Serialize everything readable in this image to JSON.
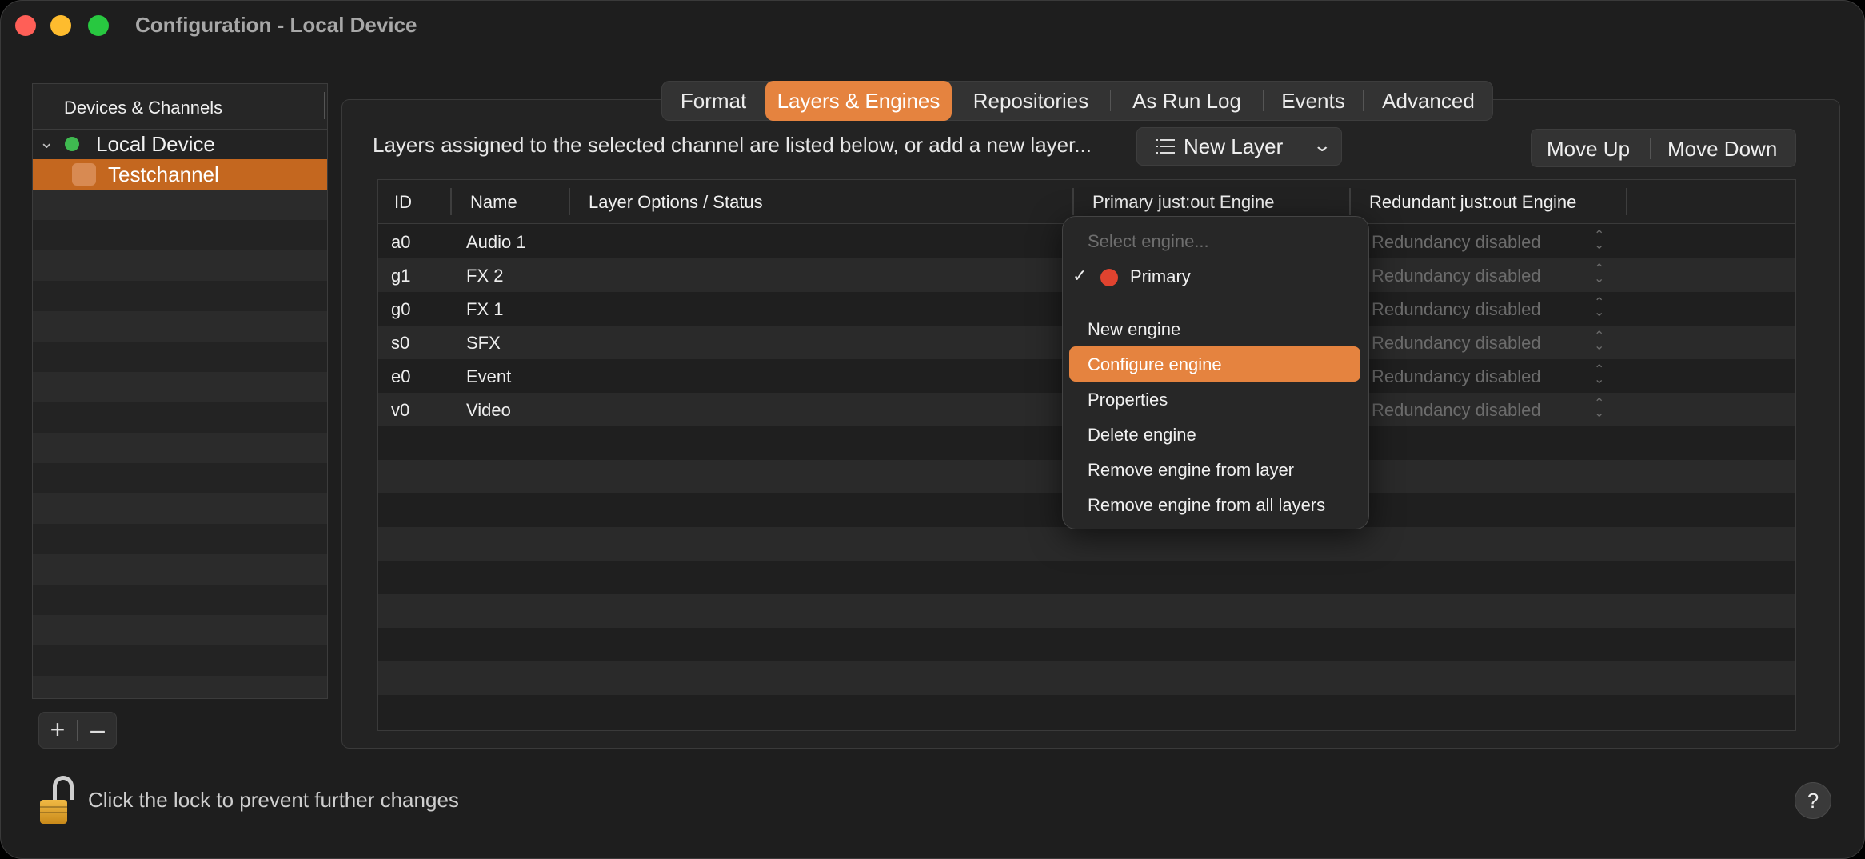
{
  "window": {
    "title": "Configuration - Local Device"
  },
  "sidebar": {
    "header": "Devices & Channels",
    "device": {
      "label": "Local Device",
      "status_color": "#3fb950"
    },
    "channel": {
      "label": "Testchannel"
    },
    "add_label": "+",
    "remove_label": "–"
  },
  "tabs": [
    "Format",
    "Layers & Engines",
    "Repositories",
    "As Run Log",
    "Events",
    "Advanced"
  ],
  "active_tab": "Layers & Engines",
  "toolbar": {
    "info": "Layers assigned to the selected channel are listed below, or add a new layer...",
    "new_layer": "New Layer",
    "move_up": "Move Up",
    "move_down": "Move Down"
  },
  "table": {
    "columns": [
      "ID",
      "Name",
      "Layer Options / Status",
      "Primary just:out Engine",
      "Redundant just:out Engine"
    ],
    "rows": [
      {
        "id": "a0",
        "name": "Audio 1",
        "redundant": "Redundancy disabled"
      },
      {
        "id": "g1",
        "name": "FX 2",
        "redundant": "Redundancy disabled"
      },
      {
        "id": "g0",
        "name": "FX 1",
        "redundant": "Redundancy disabled"
      },
      {
        "id": "s0",
        "name": "SFX",
        "redundant": "Redundancy disabled"
      },
      {
        "id": "e0",
        "name": "Event",
        "redundant": "Redundancy disabled"
      },
      {
        "id": "v0",
        "name": "Video",
        "redundant": "Redundancy disabled"
      }
    ]
  },
  "context_menu": {
    "placeholder": "Select engine...",
    "checked_item": "Primary",
    "checked_color": "#e0432f",
    "items": [
      "New engine",
      "Configure engine",
      "Properties",
      "Delete engine",
      "Remove engine from layer",
      "Remove engine from all layers"
    ],
    "highlighted": "Configure engine"
  },
  "footer": {
    "lock_text": "Click the lock to prevent further changes",
    "help": "?"
  },
  "colors": {
    "accent": "#e5833f",
    "selection": "#c4671f"
  }
}
